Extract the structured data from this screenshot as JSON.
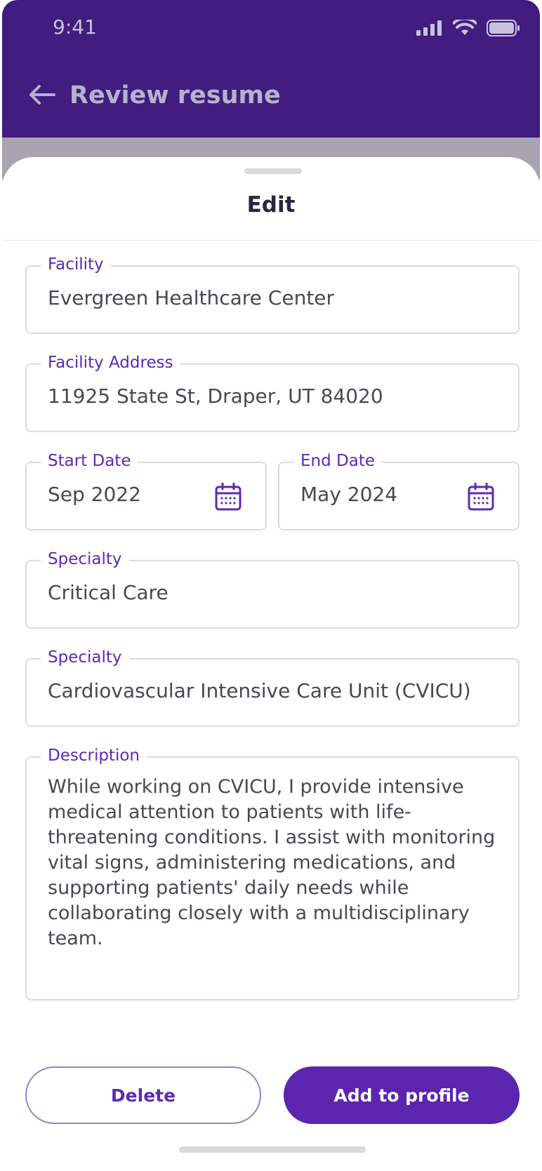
{
  "status_bar": {
    "time": "9:41"
  },
  "header": {
    "title": "Review resume"
  },
  "sheet": {
    "title": "Edit"
  },
  "form": {
    "facility": {
      "label": "Facility",
      "value": "Evergreen Healthcare Center"
    },
    "facility_address": {
      "label": "Facility Address",
      "value": "11925 State St, Draper, UT 84020"
    },
    "start_date": {
      "label": "Start Date",
      "value": "Sep 2022"
    },
    "end_date": {
      "label": "End Date",
      "value": "May 2024"
    },
    "specialty_1": {
      "label": "Specialty",
      "value": "Critical Care"
    },
    "specialty_2": {
      "label": "Specialty",
      "value": "Cardiovascular Intensive Care Unit (CVICU)"
    },
    "description": {
      "label": "Description",
      "value": "While working on CVICU, I provide intensive medical attention to patients with life-threatening conditions. I assist with monitoring vital signs, administering medications, and supporting patients' daily needs while collaborating closely with a multidisciplinary team."
    }
  },
  "actions": {
    "delete_label": "Delete",
    "add_label": "Add to profile"
  },
  "colors": {
    "header_bg": "#401d7f",
    "accent": "#5b25b0",
    "label": "#5b2bb3"
  },
  "icons": [
    "signal-icon",
    "wifi-icon",
    "battery-icon",
    "back-arrow-icon",
    "calendar-icon"
  ]
}
